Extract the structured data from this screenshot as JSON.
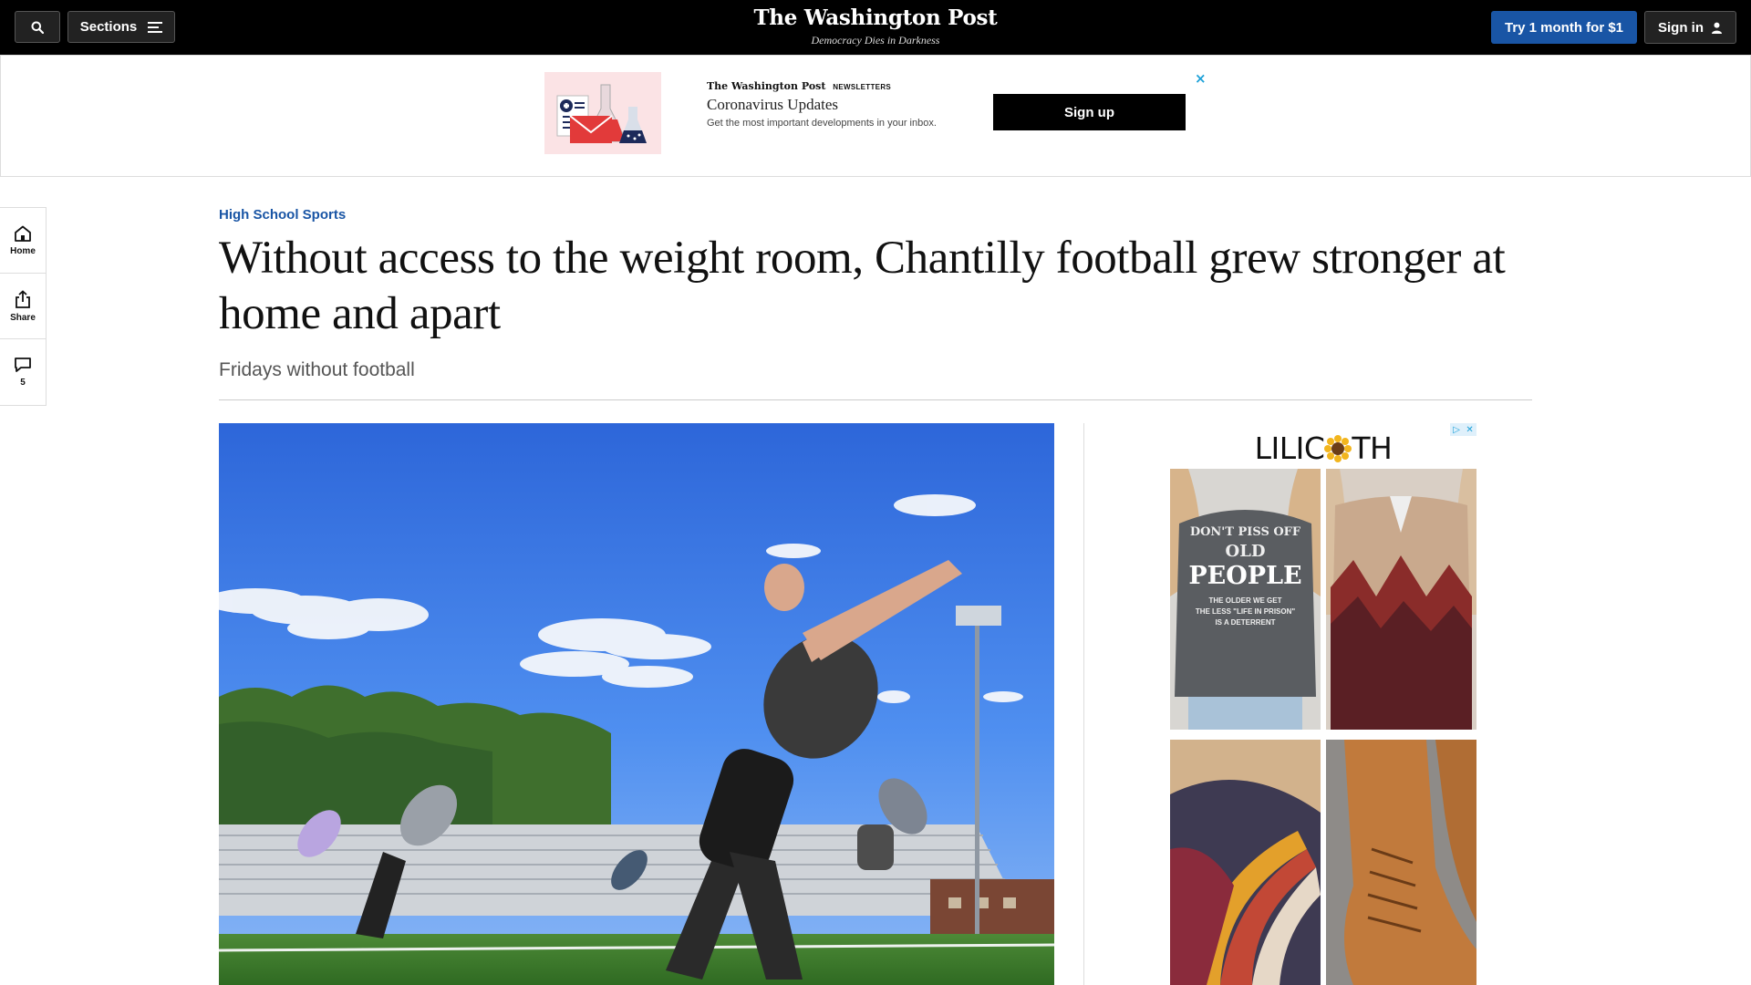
{
  "nav": {
    "sections_label": "Sections",
    "logo": "The Washington Post",
    "tagline": "Democracy Dies in Darkness",
    "try_label": "Try 1 month for $1",
    "signin_label": "Sign in"
  },
  "promo": {
    "brand": "The Washington Post",
    "brand_suffix": "NEWSLETTERS",
    "title": "Coronavirus Updates",
    "description": "Get the most important developments in your inbox.",
    "signup_label": "Sign up",
    "close_glyph": "×"
  },
  "rail": {
    "home_label": "Home",
    "share_label": "Share",
    "comments_count": "5"
  },
  "article": {
    "kicker": "High School Sports",
    "headline": "Without access to the weight room, Chantilly football grew stronger at home and apart",
    "subhead": "Fridays without football"
  },
  "ad": {
    "logo_left": "LILIC",
    "logo_right": "TH",
    "shirt_text_1": "DON'T PISS OFF",
    "shirt_text_2": "OLD",
    "shirt_text_3": "PEOPLE",
    "shirt_text_4": "THE OLDER WE GET",
    "shirt_text_5": "THE LESS \"LIFE IN PRISON\"",
    "shirt_text_6": "IS A DETERRENT",
    "choice_glyph_1": "▷",
    "choice_glyph_2": "✕"
  },
  "colors": {
    "accent": "#1955a5",
    "nav_bg": "#000000",
    "kicker": "#1955a5",
    "adchoice": "#1ba0d8"
  },
  "icons": [
    "search-icon",
    "menu-icon",
    "user-icon",
    "home-icon",
    "share-icon",
    "comment-icon",
    "close-icon"
  ]
}
